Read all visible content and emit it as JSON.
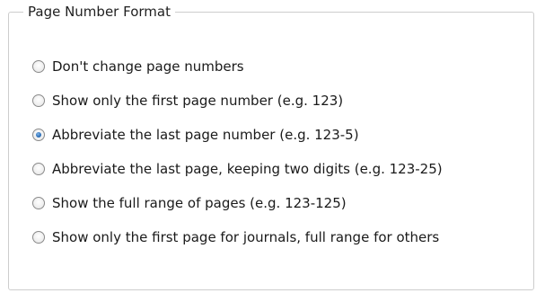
{
  "group": {
    "title": "Page Number Format"
  },
  "options": [
    {
      "label": "Don't change page numbers",
      "checked": false
    },
    {
      "label": "Show only the first page number (e.g. 123)",
      "checked": false
    },
    {
      "label": "Abbreviate the last page number (e.g. 123-5)",
      "checked": true
    },
    {
      "label": "Abbreviate the last page, keeping two digits (e.g. 123-25)",
      "checked": false
    },
    {
      "label": "Show the full range of pages (e.g. 123-125)",
      "checked": false
    },
    {
      "label": "Show only the first page for journals, full range for others",
      "checked": false
    }
  ]
}
